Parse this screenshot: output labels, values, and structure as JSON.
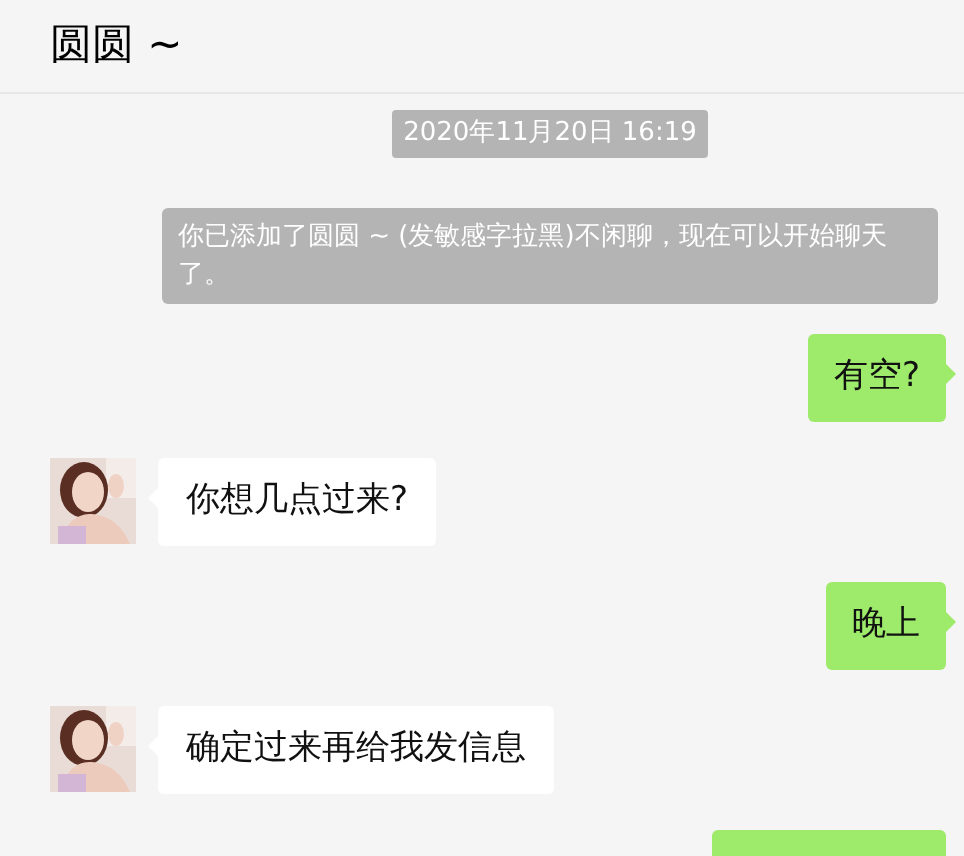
{
  "chat": {
    "title": "圆圆 ~"
  },
  "timestamp": "2020年11月20日 16:19",
  "system_message": "你已添加了圆圆 ~ (发敏感字拉黑)不闲聊，现在可以开始聊天了。",
  "messages": [
    {
      "kind": "outgoing",
      "text": "有空?"
    },
    {
      "kind": "incoming",
      "text": "你想几点过来?"
    },
    {
      "kind": "outgoing",
      "text": "晚上"
    },
    {
      "kind": "incoming",
      "text": "确定过来再给我发信息"
    },
    {
      "kind": "outgoing"
    }
  ]
}
